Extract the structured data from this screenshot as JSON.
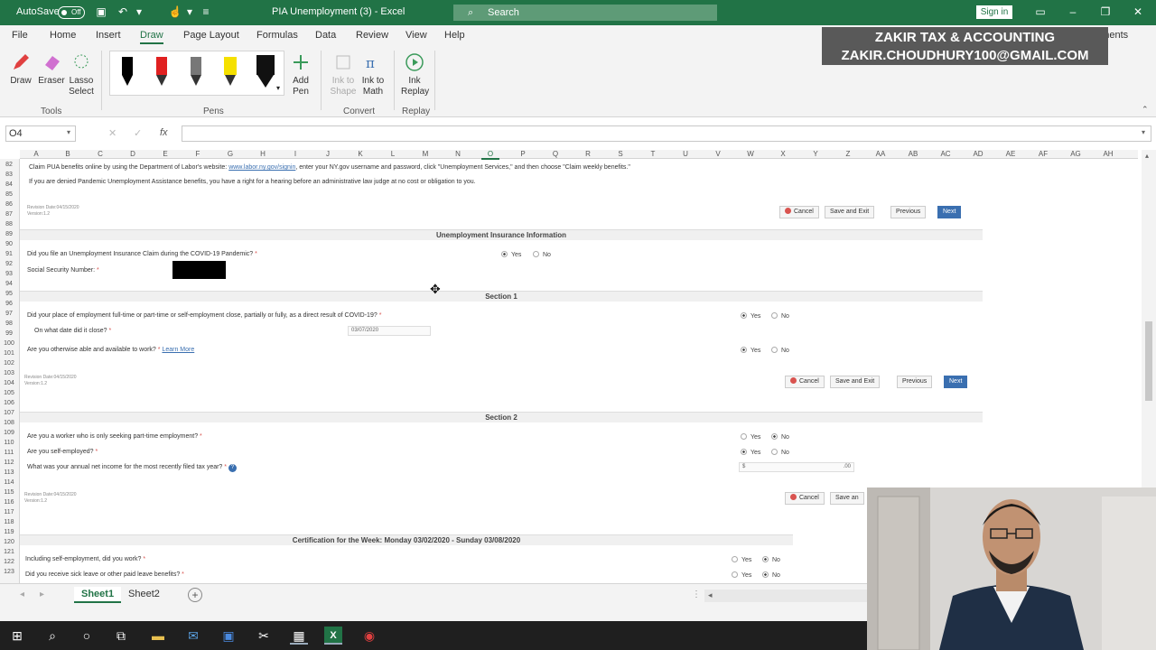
{
  "titlebar": {
    "autosave_label": "AutoSave",
    "autosave_state": "Off",
    "doc_title": "PIA Unemployment (3) - Excel",
    "search_placeholder": "Search",
    "sign_in": "Sign in",
    "bg_color": "#217346"
  },
  "tabs": [
    "File",
    "Home",
    "Insert",
    "Draw",
    "Page Layout",
    "Formulas",
    "Data",
    "Review",
    "View",
    "Help"
  ],
  "active_tab": "Draw",
  "comments_label": "Comments",
  "watermark": {
    "line1": "ZAKIR TAX & ACCOUNTING",
    "line2": "ZAKIR.CHOUDHURY100@GMAIL.COM"
  },
  "ribbon": {
    "tools": {
      "draw": "Draw",
      "eraser": "Eraser",
      "lasso": "Lasso Select",
      "group": "Tools"
    },
    "pens": {
      "add_pen": "Add Pen",
      "group": "Pens",
      "colors": [
        "#000000",
        "#e02020",
        "#777777",
        "#f5e000",
        "#111111"
      ]
    },
    "convert": {
      "ink_to_shape": "Ink to Shape",
      "ink_to_math": "Ink to Math",
      "group": "Convert"
    },
    "replay": {
      "ink_replay": "Ink Replay",
      "group": "Replay"
    }
  },
  "formula_bar": {
    "name_box": "O4",
    "fx": "fx",
    "value": ""
  },
  "columns": [
    "A",
    "B",
    "C",
    "D",
    "E",
    "F",
    "G",
    "H",
    "I",
    "J",
    "K",
    "L",
    "M",
    "N",
    "O",
    "P",
    "Q",
    "R",
    "S",
    "T",
    "U",
    "V",
    "W",
    "X",
    "Y",
    "Z",
    "AA",
    "AB",
    "AC",
    "AD",
    "AE",
    "AF",
    "AG",
    "AH"
  ],
  "rows": [
    "82",
    "83",
    "84",
    "85",
    "86",
    "87",
    "88",
    "89",
    "90",
    "91",
    "92",
    "93",
    "94",
    "95",
    "96",
    "97",
    "98",
    "99",
    "100",
    "101",
    "102",
    "103",
    "104",
    "105",
    "106",
    "107",
    "108",
    "109",
    "110",
    "111",
    "112",
    "113",
    "114",
    "115",
    "116",
    "117",
    "118",
    "119",
    "120",
    "121",
    "122",
    "123"
  ],
  "form": {
    "line1_pre": "Claim PUA benefits online by using the Department of Labor's website: ",
    "line1_link": "www.labor.ny.gov/signin",
    "line1_post": ", enter your NY.gov username and password, click \"Unemployment Services,\" and then choose \"Claim weekly benefits.\"",
    "line2": "If you are denied Pandemic Unemployment Assistance benefits, you have a right for a hearing before an administrative law judge at no cost or obligation to you.",
    "revision": "Revision Date:04/15/2020",
    "version": "Version:1.2",
    "buttons": {
      "cancel": "Cancel",
      "save_exit": "Save and Exit",
      "previous": "Previous",
      "next": "Next",
      "save_partial": "Save an"
    },
    "ui_header": "Unemployment Insurance Information",
    "ui_q1": "Did you file an Unemployment Insurance Claim during the COVID-19 Pandemic?",
    "ssn_label": "Social Security Number:",
    "yes": "Yes",
    "no": "No",
    "section1": "Section 1",
    "s1_q1": "Did your place of employment full-time or part-time or self-employment close, partially or fully, as a direct result of COVID-19?",
    "s1_q2": "On what date did it close?",
    "s1_date": "03/07/2020",
    "s1_q3": "Are you otherwise able and available to work?",
    "learn_more": "Learn More",
    "section2": "Section 2",
    "s2_q1": "Are you a worker who is only seeking part-time employment?",
    "s2_q2": "Are you self-employed?",
    "s2_q3": "What was your annual net income for the most recently filed tax year?",
    "currency": "$",
    "cents": ".00",
    "cert_header": "Certification for the Week: Monday 03/02/2020 - Sunday 03/08/2020",
    "c_q1": "Including self-employment, did you work?",
    "c_q2": "Did you receive sick leave or other paid leave benefits?"
  },
  "sheets": [
    "Sheet1",
    "Sheet2"
  ],
  "active_sheet": "Sheet1"
}
